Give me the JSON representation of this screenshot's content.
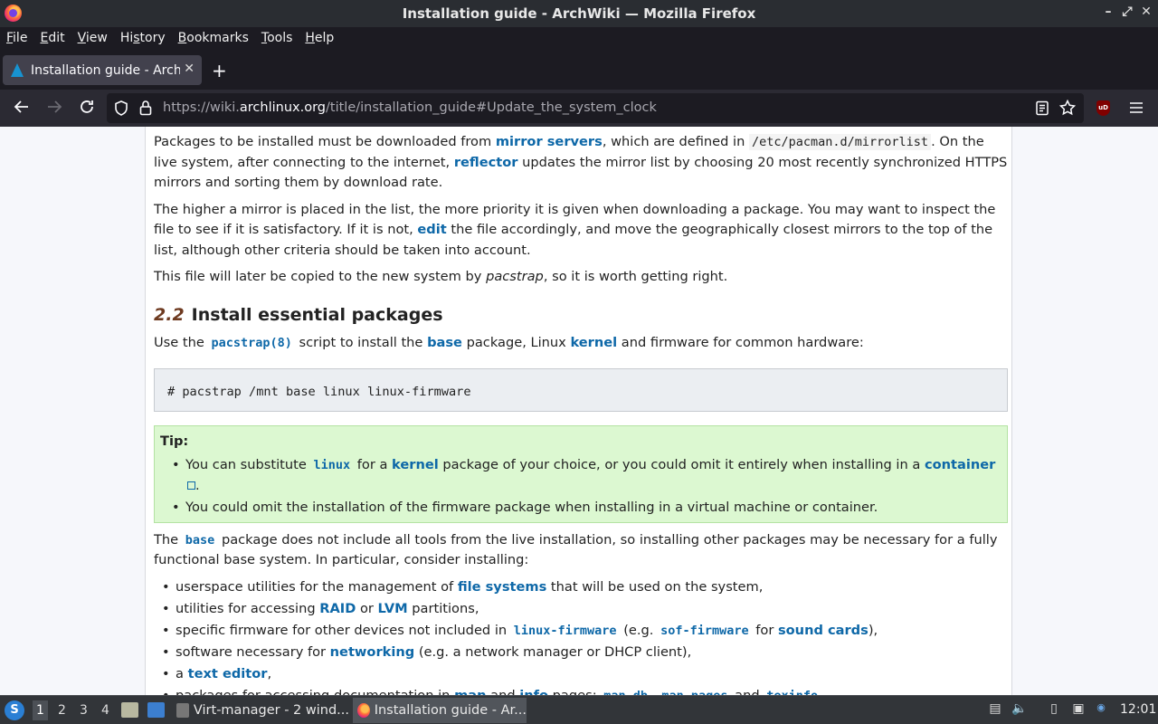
{
  "window": {
    "title": "Installation guide - ArchWiki — Mozilla Firefox",
    "controls": [
      "–",
      "⤢",
      "✕"
    ]
  },
  "menubar": {
    "items": [
      {
        "label": "File",
        "u": "F",
        "rest": "ile"
      },
      {
        "label": "Edit",
        "u": "E",
        "rest": "dit"
      },
      {
        "label": "View",
        "u": "V",
        "rest": "iew"
      },
      {
        "label": "History",
        "u": "",
        "pre": "Hi",
        "uc": "s",
        "post": "tory"
      },
      {
        "label": "Bookmarks",
        "u": "B",
        "rest": "ookmarks"
      },
      {
        "label": "Tools",
        "u": "T",
        "rest": "ools"
      },
      {
        "label": "Help",
        "u": "H",
        "rest": "elp"
      }
    ]
  },
  "tabs": [
    {
      "title": "Installation guide - ArchWiki",
      "active": true
    }
  ],
  "navbar": {
    "url_prefix": "https://wiki.",
    "url_host": "archlinux.org",
    "url_path": "/title/installation_guide#Update_the_system_clock"
  },
  "article": {
    "p1": {
      "t1": "Packages to be installed must be downloaded from ",
      "l1": "mirror servers",
      "t2": ", which are defined in ",
      "c1": "/etc/pacman.d/mirrorlist",
      "t3": ". On the live system, after connecting to the internet, ",
      "l2": "reflector",
      "t4": " updates the mirror list by choosing 20 most recently synchronized HTTPS mirrors and sorting them by download rate."
    },
    "p2": {
      "t1": "The higher a mirror is placed in the list, the more priority it is given when downloading a package. You may want to inspect the file to see if it is satisfactory. If it is not, ",
      "l1": "edit",
      "t2": " the file accordingly, and move the geographically closest mirrors to the top of the list, although other criteria should be taken into account."
    },
    "p3": {
      "t1": "This file will later be copied to the new system by ",
      "em": "pacstrap",
      "t2": ", so it is worth getting right."
    },
    "h2": {
      "num": "2.2",
      "title": "Install essential packages"
    },
    "p4": {
      "t1": "Use the ",
      "l1": "pacstrap(8)",
      "t2": " script to install the ",
      "l2": "base",
      "t3": " package, Linux ",
      "l3": "kernel",
      "t4": " and firmware for common hardware:"
    },
    "code": "# pacstrap /mnt base linux linux-firmware",
    "tip": {
      "title": "Tip:",
      "i1": {
        "t1": "You can substitute ",
        "l1": "linux",
        "t2": " for a ",
        "l2": "kernel",
        "t3": " package of your choice, or you could omit it entirely when installing in a ",
        "l3": "container",
        "t4": "."
      },
      "i2": "You could omit the installation of the firmware package when installing in a virtual machine or container."
    },
    "p5": {
      "t1": "The ",
      "l1": "base",
      "t2": " package does not include all tools from the live installation, so installing other packages may be necessary for a fully functional base system. In particular, consider installing:"
    },
    "list": {
      "i1": {
        "t1": "userspace utilities for the management of ",
        "l1": "file systems",
        "t2": " that will be used on the system,"
      },
      "i2": {
        "t1": "utilities for accessing ",
        "l1": "RAID",
        "t2": " or ",
        "l2": "LVM",
        "t3": " partitions,"
      },
      "i3": {
        "t1": "specific firmware for other devices not included in ",
        "l1": "linux-firmware",
        "t2": " (e.g. ",
        "l2": "sof-firmware",
        "t3": " for ",
        "l3": "sound cards",
        "t4": "),"
      },
      "i4": {
        "t1": "software necessary for ",
        "l1": "networking",
        "t2": " (e.g. a network manager or DHCP client),"
      },
      "i5": {
        "t1": "a ",
        "l1": "text editor",
        "t2": ","
      },
      "i6": {
        "t1": "packages for accessing documentation in ",
        "l1": "man",
        "t2": " and ",
        "l2": "info",
        "t3": " pages: ",
        "l3": "man-db",
        "t4": ", ",
        "l4": "man-pages",
        "t5": " and ",
        "l5": "texinfo",
        "t6": "."
      }
    }
  },
  "taskbar": {
    "workspaces": [
      "1",
      "2",
      "3",
      "4"
    ],
    "tasks": [
      {
        "label": "Virt-manager - 2 wind..."
      },
      {
        "label": "Installation guide - Ar..."
      }
    ],
    "clock": "12:01"
  }
}
